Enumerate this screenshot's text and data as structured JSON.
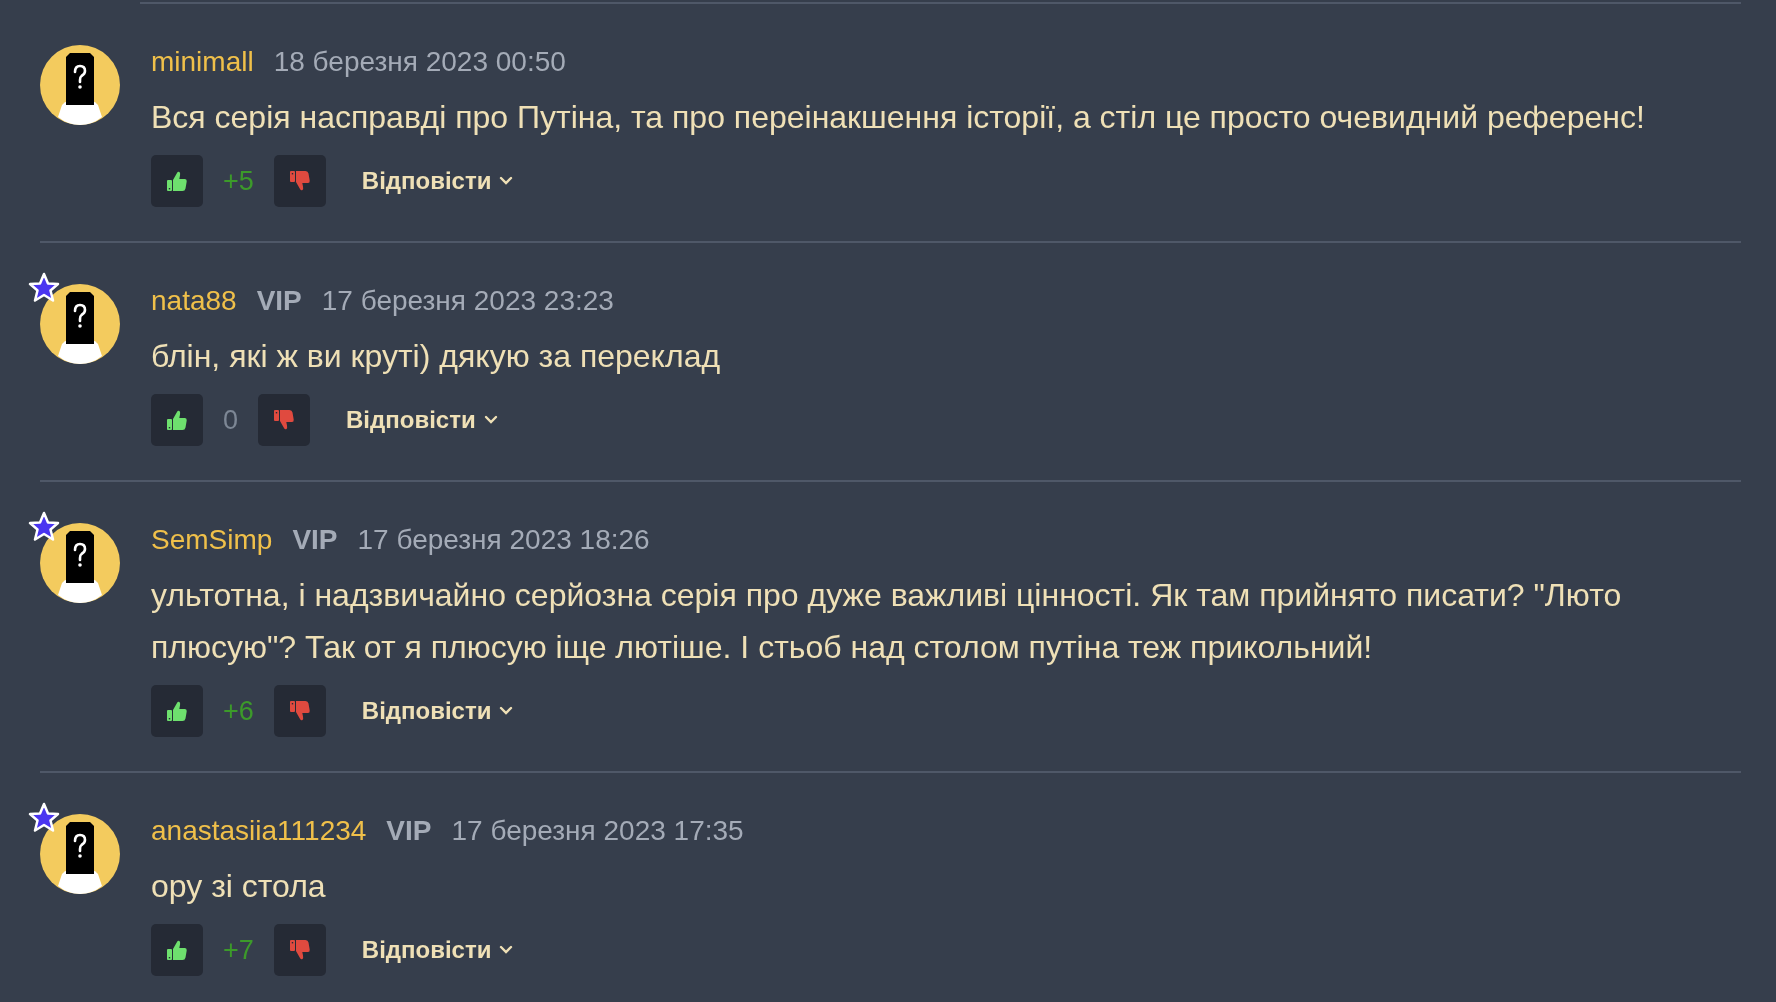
{
  "comments": [
    {
      "author": "minimall",
      "vip": false,
      "date": "18 березня 2023 00:50",
      "text": "Вся серія насправді про Путіна, та про переінакшення історії, а стіл це просто очевидний референс!",
      "score": "+5",
      "color": "#3c9a2a",
      "reply": "Відповісти"
    },
    {
      "author": "nata88",
      "vip": true,
      "vip_label": "VIP",
      "date": "17 березня 2023 23:23",
      "text": "блін, які ж ви круті) дякую за переклад",
      "score": "0",
      "color": "#7d8795",
      "reply": "Відповісти"
    },
    {
      "author": "SemSimp",
      "vip": true,
      "vip_label": "VIP",
      "date": "17 березня 2023 18:26",
      "text": "ультотна, і надзвичайно серйозна серія про дуже важливі цінності. Як там прийнято писати? \"Люто плюсую\"? Так от я плюсую іще лютіше. І стьоб над столом путіна теж прикольний!",
      "score": "+6",
      "color": "#3c9a2a",
      "reply": "Відповісти"
    },
    {
      "author": "anastasiia111234",
      "vip": true,
      "vip_label": "VIP",
      "date": "17 березня 2023 17:35",
      "text": "ору зі стола",
      "score": "+7",
      "color": "#3c9a2a",
      "reply": "Відповісти"
    }
  ]
}
